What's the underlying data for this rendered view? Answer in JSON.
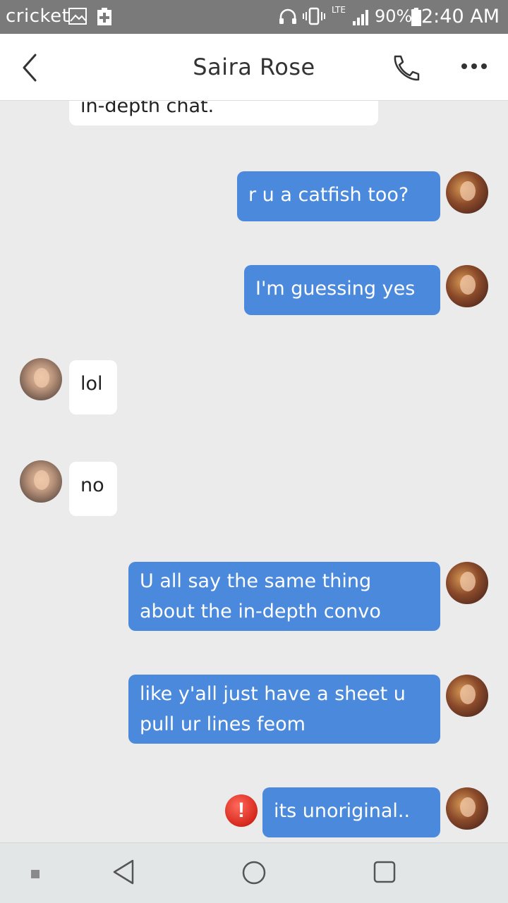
{
  "status_bar": {
    "carrier": "cricket",
    "lte": "LTE",
    "battery": "90%",
    "time": "12:40 AM"
  },
  "header": {
    "title": "Saira Rose"
  },
  "messages": [
    {
      "from": "contact",
      "text": "in-depth chat."
    },
    {
      "from": "me",
      "text": "r u a catfish too?"
    },
    {
      "from": "me",
      "text": "I'm guessing yes"
    },
    {
      "from": "contact",
      "text": "lol"
    },
    {
      "from": "contact",
      "text": "no"
    },
    {
      "from": "me",
      "text": "U all say the same thing about the in-depth convo"
    },
    {
      "from": "me",
      "text": "like y'all just have a sheet u pull ur lines feom"
    },
    {
      "from": "me",
      "text": "its unoriginal..",
      "failed": true
    }
  ],
  "error_badge": "!",
  "colors": {
    "outgoing_bubble": "#4a89dc",
    "incoming_bubble": "#ffffff",
    "background": "#ebebeb",
    "status_bar": "#7a7a7a",
    "error": "#d6281c"
  },
  "icons": [
    "back-chevron-icon",
    "phone-icon",
    "more-dots-icon",
    "error-icon",
    "nav-back-icon",
    "nav-home-icon",
    "nav-recents-icon"
  ]
}
